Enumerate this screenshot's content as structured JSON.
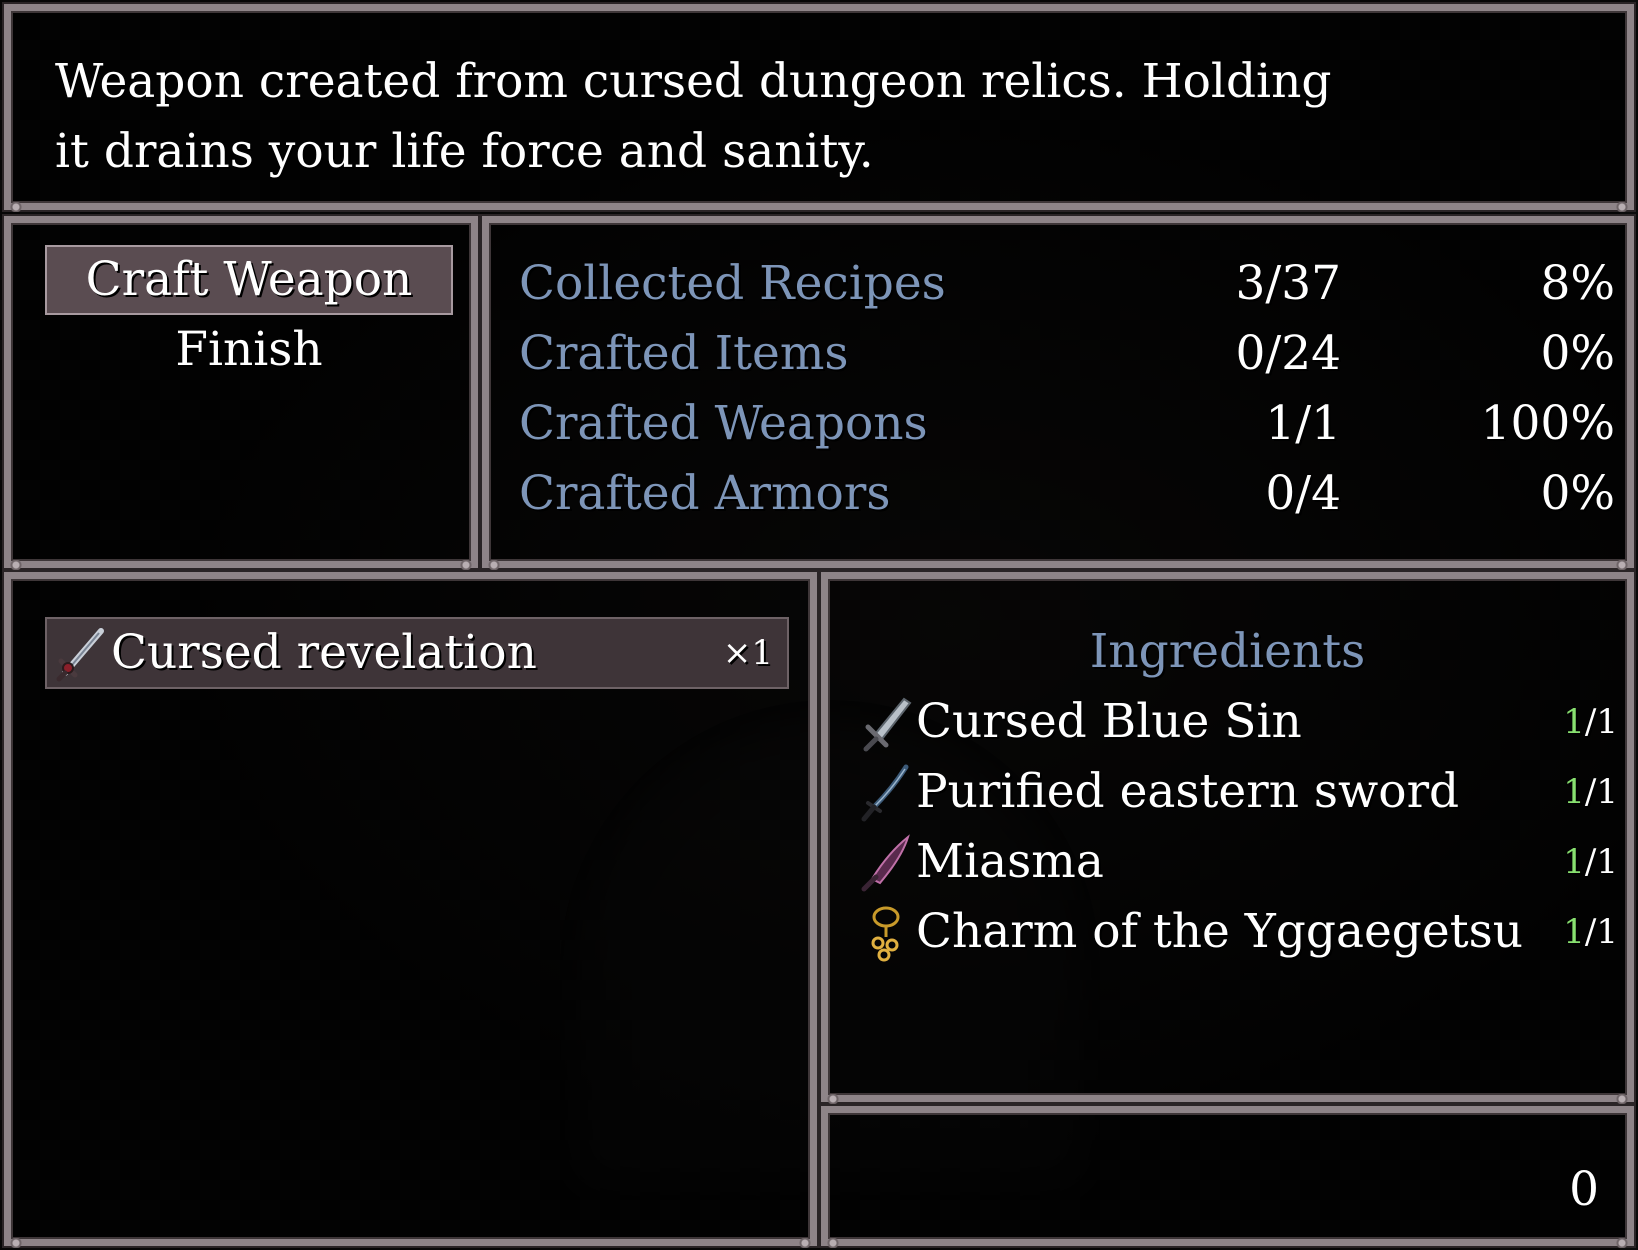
{
  "help": {
    "line1": "Weapon created from cursed dungeon relics. Holding",
    "line2": "it drains your life force and sanity."
  },
  "commands": [
    {
      "label": "Craft Weapon",
      "selected": true
    },
    {
      "label": "Finish",
      "selected": false
    }
  ],
  "stats": [
    {
      "label": "Collected Recipes",
      "count": "3/37",
      "percent": "8%"
    },
    {
      "label": "Crafted Items",
      "count": "0/24",
      "percent": "0%"
    },
    {
      "label": "Crafted Weapons",
      "count": "1/1",
      "percent": "100%"
    },
    {
      "label": "Crafted Armors",
      "count": "0/4",
      "percent": "0%"
    }
  ],
  "recipes": [
    {
      "name": "Cursed revelation",
      "quantity": "×1",
      "icon": "sword-icon"
    }
  ],
  "ingredients": {
    "title": "Ingredients",
    "items": [
      {
        "name": "Cursed Blue Sin",
        "have": "1",
        "need": "/1",
        "icon": "greatsword-icon"
      },
      {
        "name": "Purified eastern sword",
        "have": "1",
        "need": "/1",
        "icon": "katana-icon"
      },
      {
        "name": "Miasma",
        "have": "1",
        "need": "/1",
        "icon": "scythe-blade-icon"
      },
      {
        "name": "Charm of the Yggaegetsu",
        "have": "1",
        "need": "/1",
        "icon": "charm-icon"
      }
    ]
  },
  "number_window": {
    "value": "0"
  },
  "colors": {
    "system_label": "#7d95b8",
    "have_enough": "#88e070",
    "selection_bg": "#5a4c51",
    "frame": "#8e8488"
  }
}
